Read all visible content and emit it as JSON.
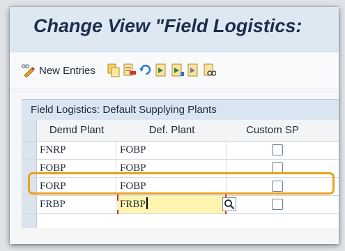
{
  "header": {
    "title": "Change View \"Field Logistics:"
  },
  "toolbar": {
    "new_entries_label": "New Entries",
    "icons": [
      "new-entries-icon",
      "copy-icon",
      "delete-icon",
      "undo-icon",
      "select-all-icon",
      "select-block-icon",
      "deselect-all-icon",
      "display-details-icon"
    ]
  },
  "section": {
    "title": "Field Logistics: Default Supplying Plants"
  },
  "table": {
    "columns": [
      "Demd Plant",
      "Def. Plant",
      "Custom SP"
    ],
    "rows": [
      {
        "demd_plant": "FNRP",
        "def_plant": "FOBP",
        "custom_sp": false
      },
      {
        "demd_plant": "FOBP",
        "def_plant": "FOBP",
        "custom_sp": false
      },
      {
        "demd_plant": "FORP",
        "def_plant": "FOBP",
        "custom_sp": false
      },
      {
        "demd_plant": "FRBP",
        "def_plant": "FRBP",
        "custom_sp": false
      }
    ],
    "highlighted_row": 1,
    "active_cell": {
      "row": 3,
      "column": "def_plant"
    }
  },
  "colors": {
    "highlight": "#e8a21e",
    "active_input": "#fff5b0",
    "title_bar": "#dde8f3"
  }
}
